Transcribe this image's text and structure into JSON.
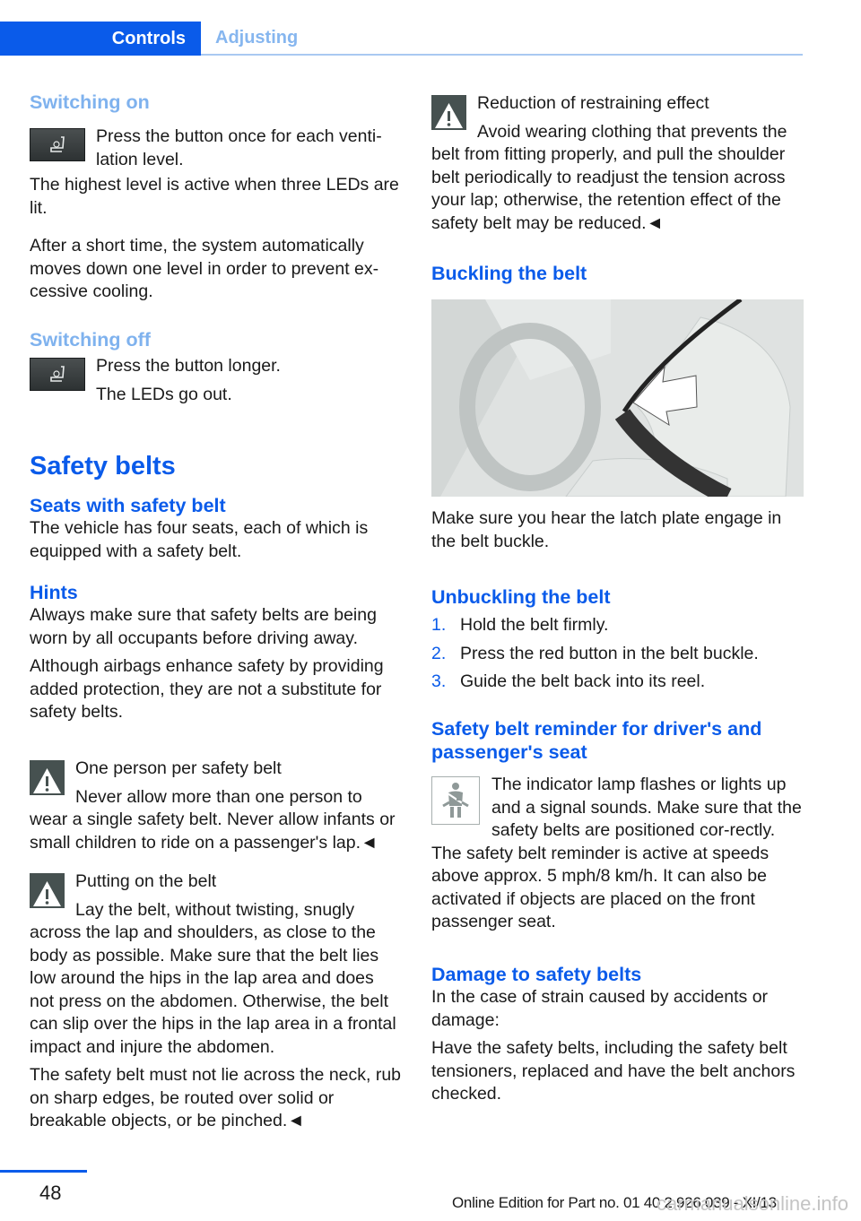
{
  "header": {
    "tabs": [
      {
        "label": "Controls",
        "active": true
      },
      {
        "label": "Adjusting",
        "active": false
      }
    ],
    "accent_color": "#0a5bea"
  },
  "left": {
    "switching_on": {
      "heading": "Switching on",
      "icon": "seat-ventilation-button-icon",
      "text1": "Press the button once for each venti-lation level.",
      "text2": "The highest level is active when three LEDs are lit.",
      "text3": "After a short time, the system automatically moves down one level in order to prevent ex-cessive cooling."
    },
    "switching_off": {
      "heading": "Switching off",
      "icon": "seat-ventilation-button-icon",
      "text1": "Press the button longer.",
      "text2": "The LEDs go out."
    },
    "safety_belts": {
      "heading": "Safety belts",
      "seats_heading": "Seats with safety belt",
      "seats_text": "The vehicle has four seats, each of which is equipped with a safety belt.",
      "hints_heading": "Hints",
      "hints_text1": "Always make sure that safety belts are being worn by all occupants before driving away.",
      "hints_text2": "Although airbags enhance safety by providing added protection, they are not a substitute for safety belts."
    },
    "warning1": {
      "icon": "warning-triangle-icon",
      "title": "One person per safety belt",
      "body": "Never allow more than one person to wear a single safety belt. Never allow infants or small children to ride on a passenger's lap.◄"
    },
    "warning2": {
      "icon": "warning-triangle-icon",
      "title": "Putting on the belt",
      "body": "Lay the belt, without twisting, snugly across the lap and shoulders, as close to the body as possible. Make sure that the belt lies low around the hips in the lap area and does not press on the abdomen. Otherwise, the belt can slip over the hips in the lap area in a frontal impact and injure the abdomen.",
      "body2": "The safety belt must not lie across the neck, rub on sharp edges, be routed over solid or breakable objects, or be pinched.◄"
    }
  },
  "right": {
    "warning3": {
      "icon": "warning-triangle-icon",
      "title": "Reduction of restraining effect",
      "body": "Avoid wearing clothing that prevents the belt from fitting properly, and pull the shoulder belt periodically to readjust the tension across your lap; otherwise, the retention effect of the safety belt may be reduced.◄"
    },
    "buckling": {
      "heading": "Buckling the belt",
      "illustration": "seat-belt-buckling-illustration",
      "text": "Make sure you hear the latch plate engage in the belt buckle."
    },
    "unbuckling": {
      "heading": "Unbuckling the belt",
      "steps": [
        {
          "num": "1.",
          "text": "Hold the belt firmly."
        },
        {
          "num": "2.",
          "text": "Press the red button in the belt buckle."
        },
        {
          "num": "3.",
          "text": "Guide the belt back into its reel."
        }
      ]
    },
    "reminder": {
      "heading": "Safety belt reminder for driver's and passenger's seat",
      "icon": "seatbelt-indicator-icon",
      "text": "The indicator lamp flashes or lights up and a signal sounds. Make sure that the safety belts are positioned cor-rectly. The safety belt reminder is active at speeds above approx. 5 mph/8 km/h. It can also be activated if objects are placed on the front passenger seat."
    },
    "damage": {
      "heading": "Damage to safety belts",
      "text1": "In the case of strain caused by accidents or damage:",
      "text2": "Have the safety belts, including the safety belt tensioners, replaced and have the belt anchors checked."
    }
  },
  "footer": {
    "page_number": "48",
    "edition": "Online Edition for Part no. 01 40 2 926 039 - XI/13",
    "watermark": "carmanualsonline.info"
  }
}
